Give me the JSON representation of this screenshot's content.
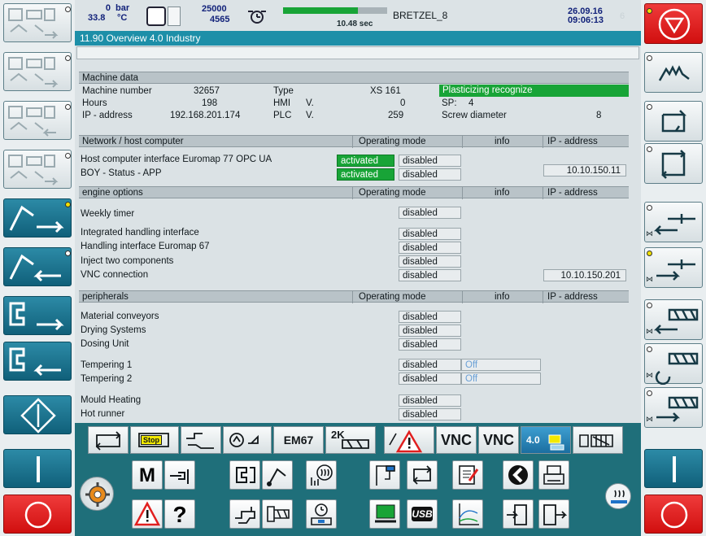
{
  "topbar": {
    "pressure_value": "0",
    "pressure_unit": "bar",
    "temp_value": "33.8",
    "temp_unit": "°C",
    "counter_top": "25000",
    "counter_bottom": "4565",
    "cycle_time": "10.48 sec",
    "cycle_progress": 0.72,
    "machine_name": "BRETZEL_8",
    "date": "26.09.16",
    "time": "09:06:13",
    "page_number": "6"
  },
  "title": "11.90 Overview 4.0 Industry",
  "machine": {
    "header": "Machine data",
    "number_label": "Machine number",
    "number_value": "32657",
    "type_label": "Type",
    "type_value": "XS 161",
    "status": "Plasticizing recognize",
    "hours_label": "Hours",
    "hours_value": "198",
    "hmi_label": "HMI",
    "hmi_v": "V.",
    "hmi_value": "0",
    "sp_label": "SP:",
    "sp_value": "4",
    "ip_label": "IP - address",
    "ip_value": "192.168.201.174",
    "plc_label": "PLC",
    "plc_v": "V.",
    "plc_value": "259",
    "screw_label": "Screw diameter",
    "screw_value": "8"
  },
  "sections": {
    "network": {
      "title": "Network / host computer",
      "col_mode": "Operating mode",
      "col_info": "info",
      "col_ip": "IP - address",
      "rows": [
        {
          "label": "Host computer interface Euromap 77 OPC UA",
          "activated": "activated",
          "disabled": "disabled"
        },
        {
          "label": "BOY - Status - APP",
          "activated": "activated",
          "disabled": "disabled",
          "ip": "10.10.150.11"
        }
      ]
    },
    "engine": {
      "title": "engine options",
      "col_mode": "Operating mode",
      "col_info": "info",
      "col_ip": "IP - address",
      "rows": [
        {
          "label": "Weekly timer",
          "disabled": "disabled"
        },
        {
          "label": "Integrated handling interface",
          "disabled": "disabled"
        },
        {
          "label": "Handling interface Euromap 67",
          "disabled": "disabled"
        },
        {
          "label": "Inject two components",
          "disabled": "disabled"
        },
        {
          "label": "VNC connection",
          "disabled": "disabled",
          "ip": "10.10.150.201"
        }
      ]
    },
    "peripherals": {
      "title": "peripherals",
      "col_mode": "Operating mode",
      "col_info": "info",
      "col_ip": "IP - address",
      "rows": [
        {
          "label": "Material conveyors",
          "disabled": "disabled"
        },
        {
          "label": "Drying Systems",
          "disabled": "disabled"
        },
        {
          "label": "Dosing Unit",
          "disabled": "disabled"
        },
        {
          "label": "Tempering 1",
          "disabled": "disabled",
          "info": "Off"
        },
        {
          "label": "Tempering 2",
          "disabled": "disabled",
          "info": "Off"
        },
        {
          "label": "Mould Heating",
          "disabled": "disabled"
        },
        {
          "label": "Hot runner",
          "disabled": "disabled"
        }
      ]
    }
  },
  "toolbar": {
    "em67": "EM67",
    "twok": "2K",
    "vnc1": "VNC",
    "vnc2": "VNC",
    "industry": "4.0",
    "stop": "Stop"
  },
  "bottom": {
    "m_label": "M",
    "question": "?",
    "usb": "USB"
  },
  "colors": {
    "teal": "#1f6f7a",
    "green": "#18a437",
    "title_bar": "#1d8fa8",
    "red": "#d10f0f"
  }
}
